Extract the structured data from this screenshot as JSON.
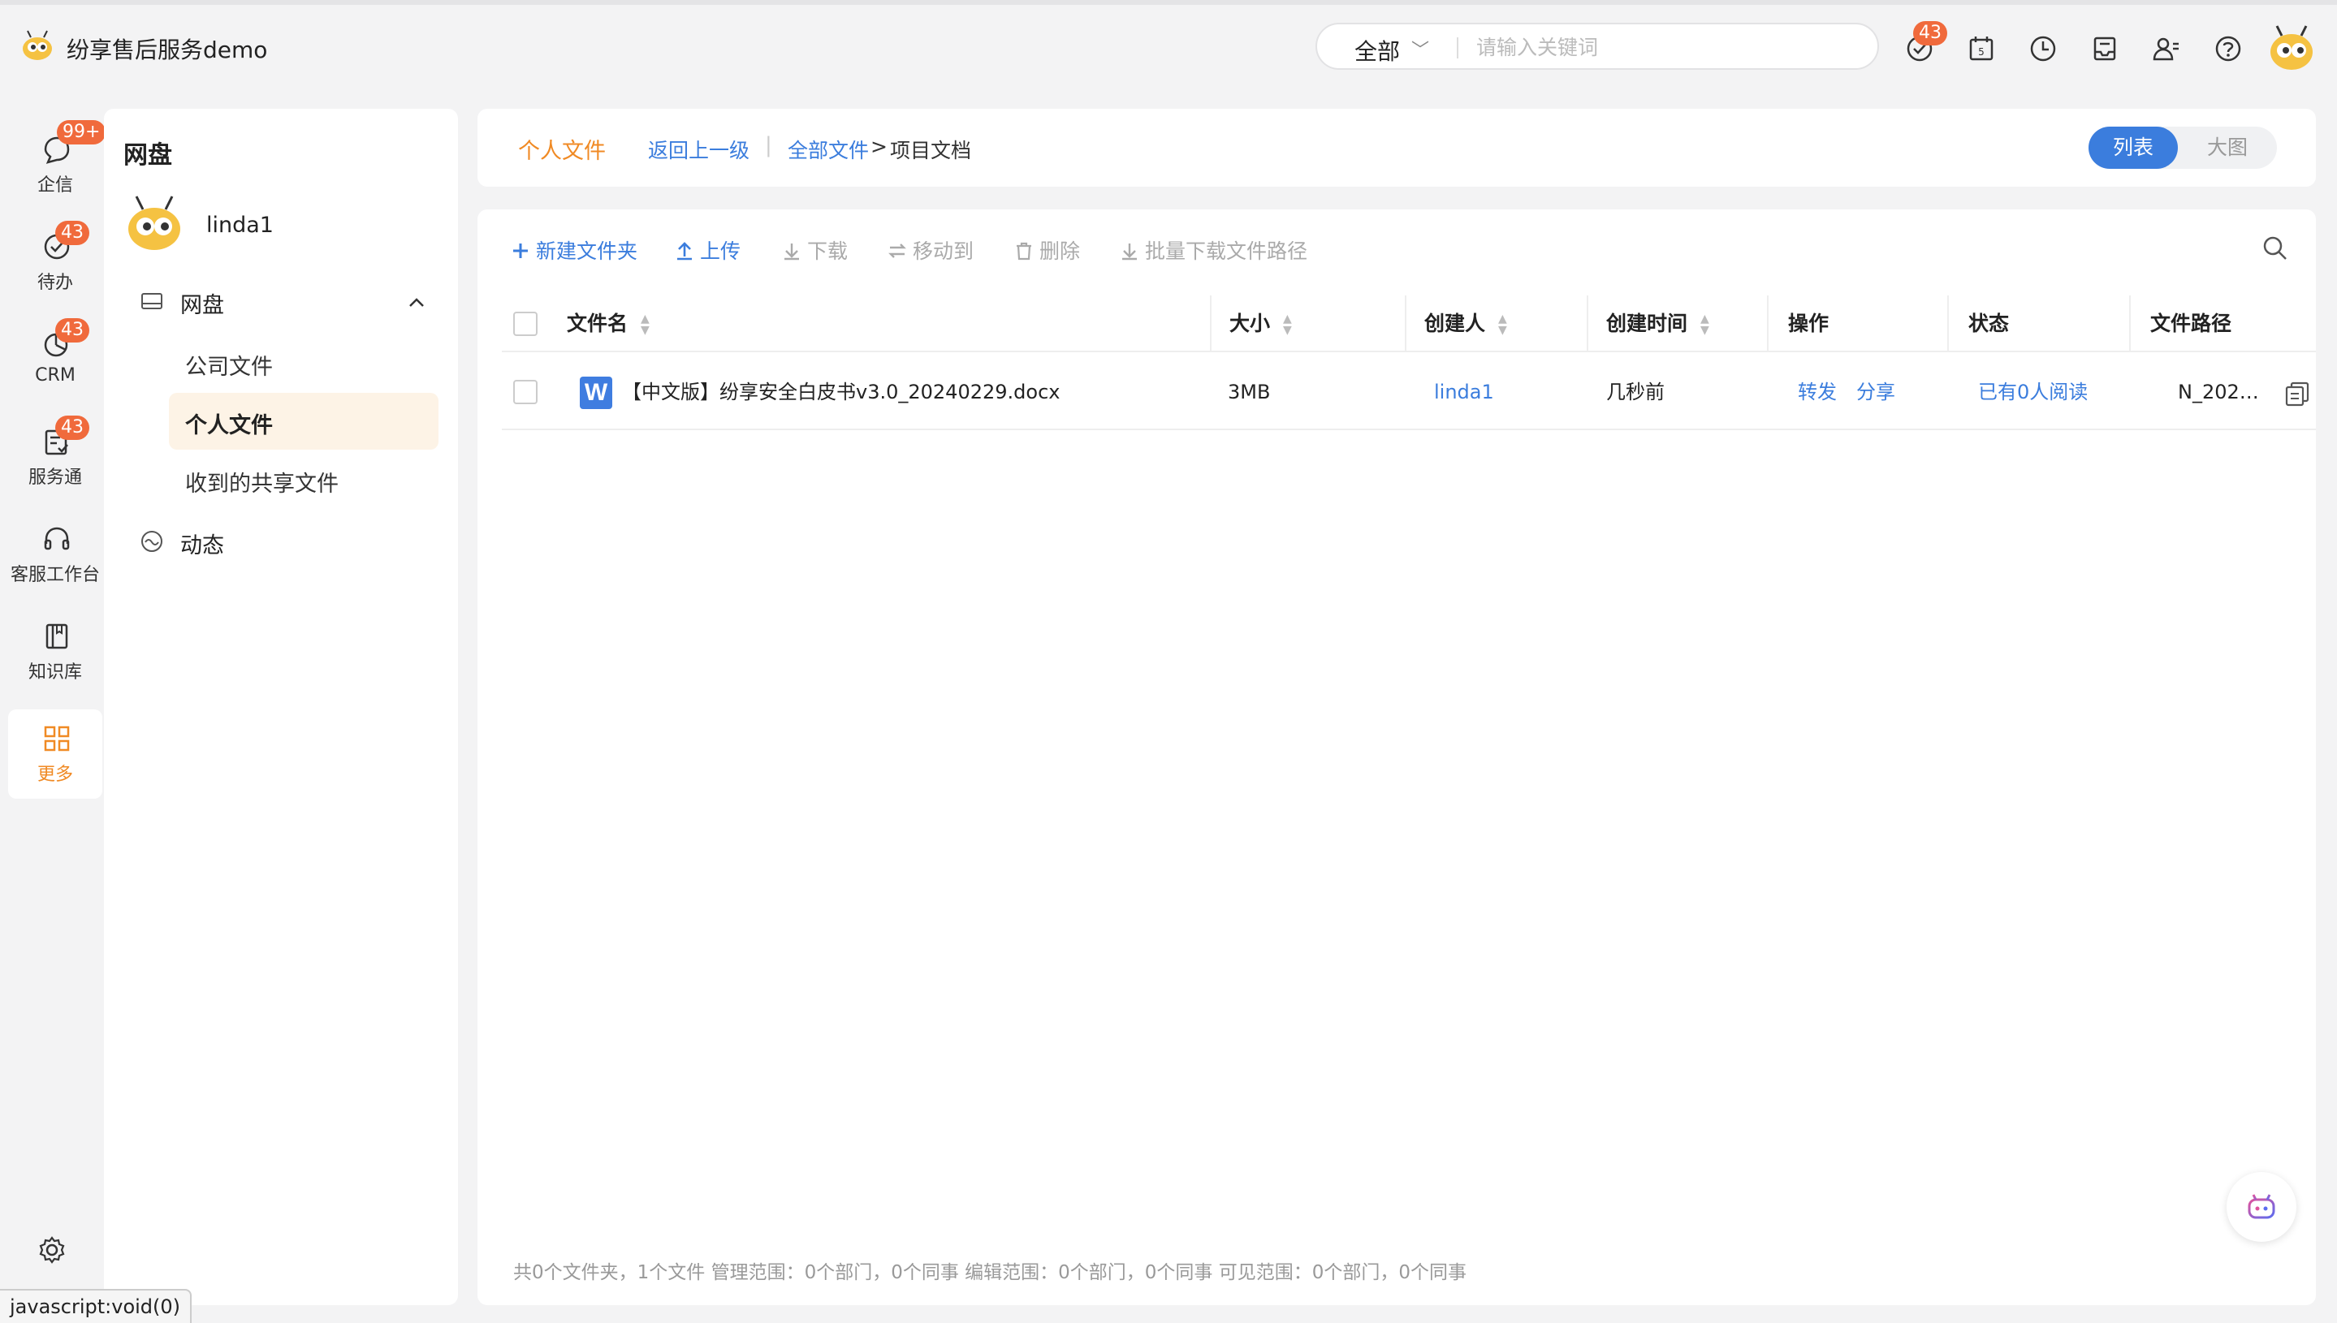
{
  "app": {
    "title": "纷享售后服务demo"
  },
  "header": {
    "search_scope": "全部",
    "search_placeholder": "请输入关键词",
    "badge_count": "43"
  },
  "rail": {
    "items": [
      {
        "label": "企信",
        "badge": "99+"
      },
      {
        "label": "待办",
        "badge": "43"
      },
      {
        "label": "CRM",
        "badge": "43"
      },
      {
        "label": "服务通",
        "badge": "43"
      },
      {
        "label": "客服工作台"
      },
      {
        "label": "知识库"
      },
      {
        "label": "更多"
      }
    ]
  },
  "left_panel": {
    "title": "网盘",
    "user": "linda1",
    "section": "网盘",
    "subitems": [
      "公司文件",
      "个人文件",
      "收到的共享文件"
    ],
    "dynamics": "动态"
  },
  "topbar": {
    "active_tab": "个人文件",
    "back": "返回上一级",
    "sep": "|",
    "crumb_root": "全部文件",
    "crumb_arrow": ">",
    "crumb_current": "项目文档",
    "view_list": "列表",
    "view_grid": "大图"
  },
  "toolbar": {
    "new_folder": "新建文件夹",
    "upload": "上传",
    "download": "下载",
    "move_to": "移动到",
    "delete": "删除",
    "batch_download_path": "批量下载文件路径"
  },
  "table": {
    "columns": [
      "文件名",
      "大小",
      "创建人",
      "创建时间",
      "操作",
      "状态",
      "文件路径"
    ],
    "rows": [
      {
        "icon_letter": "W",
        "name": "【中文版】纷享安全白皮书v3.0_20240229.docx",
        "size": "3MB",
        "creator": "linda1",
        "created": "几秒前",
        "action_forward": "转发",
        "action_share": "分享",
        "status": "已有0人阅读",
        "path": "N_202…"
      }
    ]
  },
  "footer": {
    "summary": "共0个文件夹，1个文件    管理范围：0个部门，0个同事    编辑范围：0个部门，0个同事    可见范围：0个部门，0个同事"
  },
  "status_bar": {
    "url": "javascript:void(0)"
  },
  "colors": {
    "accent": "#f08a24",
    "link": "#3b7ddd",
    "badge": "#f06a3c"
  }
}
